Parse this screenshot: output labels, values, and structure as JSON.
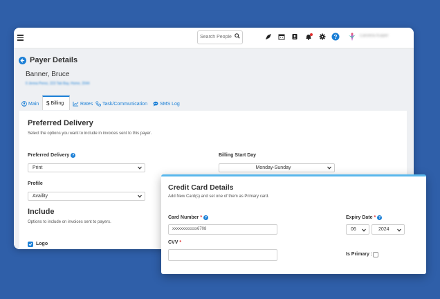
{
  "colors": {
    "background": "#2f5fa9",
    "accent": "#1b7fd6",
    "modal_accent": "#58b7ec",
    "required": "#e03131"
  },
  "topbar": {
    "search_placeholder": "Search People...",
    "icons": [
      "rocket-icon",
      "calendar-icon",
      "contacts-icon",
      "bell-icon",
      "gear-icon",
      "help-icon"
    ],
    "user_name": "Carolina Kuiper"
  },
  "page": {
    "title": "Payer Details",
    "payer_name": "Banner, Bruce",
    "payer_sub": "0 Jenna Perez, 223 Tab Bay, Home, 2044"
  },
  "tabs": [
    {
      "label": "Main",
      "icon": "user-circle-icon"
    },
    {
      "label": "Billing",
      "icon": "dollar-icon",
      "active": true
    },
    {
      "label": "Rates",
      "icon": "chart-icon"
    },
    {
      "label": "Task/Communication",
      "icon": "phone-icon"
    },
    {
      "label": "SMS Log",
      "icon": "chat-icon"
    }
  ],
  "billing": {
    "heading": "Preferred Delivery",
    "description": "Select the options you want to include in invoices sent to this payer.",
    "preferred_delivery_label": "Preferred Delivery",
    "preferred_delivery_value": "Print",
    "billing_start_label": "Billing Start Day",
    "billing_start_value": "Monday-Sunday",
    "profile_label": "Profile",
    "profile_value": "Availity",
    "include_heading": "Include",
    "include_description": "Options to include on invoices sent to payers.",
    "logo_label": "Logo"
  },
  "modal": {
    "title": "Credit Card Details",
    "subtitle": "Add New Card(s) and set one of them as Primary card.",
    "card_number_label": "Card Number",
    "card_number_value": "xxxxxxxxxxxx6708",
    "expiry_label": "Expiry Date",
    "expiry_month": "06",
    "expiry_year": "2024",
    "cvv_label": "CVV",
    "is_primary_label": "Is Primary :",
    "required_mark": "*"
  }
}
